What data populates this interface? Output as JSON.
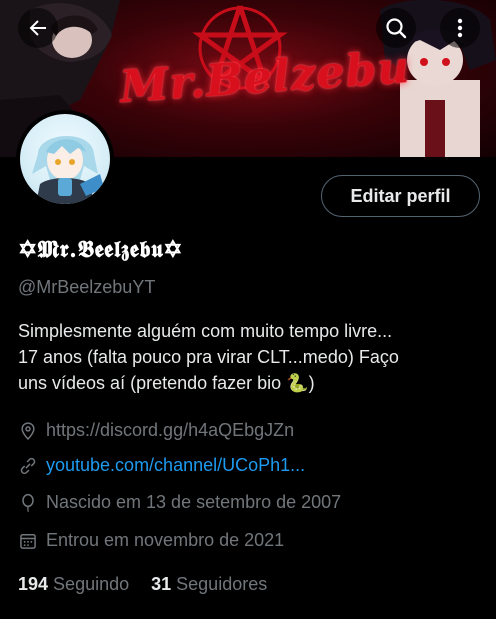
{
  "banner": {
    "title": "Mr.Belzebu",
    "colors": {
      "accent": "#d8101e",
      "background": "#3a0308"
    }
  },
  "toolbar": {
    "back_icon": "arrow-left-icon",
    "search_icon": "search-icon",
    "more_icon": "more-vertical-icon"
  },
  "profile": {
    "edit_label": "Editar perfil",
    "display_name": "✡𝕸𝖗.𝕭𝖊𝖊𝖑𝖟𝖊𝖇𝖚✡",
    "handle": "@MrBeelzebuYT",
    "bio_lines": [
      "Simplesmente alguém com muito tempo livre...",
      "17 anos (falta pouco pra virar CLT...medo) Faço",
      "uns vídeos aí  (pretendo fazer bio 🐍)"
    ],
    "location": "https://discord.gg/h4aQEbgJZn",
    "website": "youtube.com/channel/UCoPh1...",
    "birthday": "Nascido em 13 de setembro de 2007",
    "joined": "Entrou em novembro de 2021"
  },
  "stats": {
    "following_count": "194",
    "following_label": "Seguindo",
    "followers_count": "31",
    "followers_label": "Seguidores"
  },
  "colors": {
    "background": "#000000",
    "text": "#e7e9ea",
    "muted": "#71767b",
    "link": "#1d9bf0",
    "border": "#536471"
  }
}
